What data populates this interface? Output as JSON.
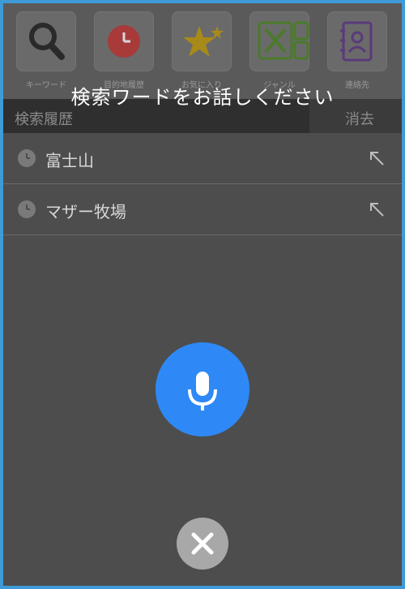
{
  "quick_actions": [
    {
      "label": "キーワード",
      "icon": "search-icon"
    },
    {
      "label": "目的地履歴",
      "icon": "history-clock-icon"
    },
    {
      "label": "お気に入り",
      "icon": "star-icon"
    },
    {
      "label": "ジャンル",
      "icon": "restaurant-icon"
    },
    {
      "label": "連絡先",
      "icon": "contacts-icon"
    }
  ],
  "voice_prompt": "検索ワードをお話しください",
  "history": {
    "title": "検索履歴",
    "clear_label": "消去",
    "items": [
      {
        "text": "富士山",
        "icon": "clock-icon"
      },
      {
        "text": "マザー牧場",
        "icon": "clock-icon"
      }
    ]
  },
  "colors": {
    "mic_button": "#2e89f6",
    "close_button": "#a8a8a8",
    "frame_border": "#3f9ad8"
  }
}
